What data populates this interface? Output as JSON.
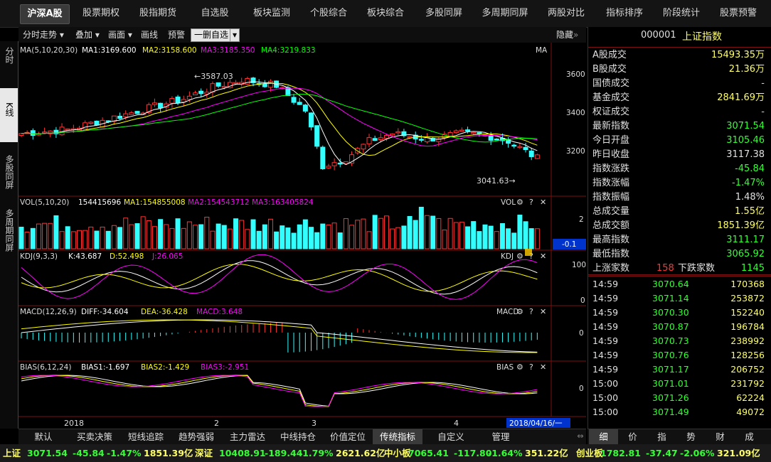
{
  "nav": [
    "沪深A股",
    "股票期权",
    "股指期货",
    "自选股",
    "板块监测",
    "个股综合",
    "板块综合",
    "多股同屏",
    "多周期同屏",
    "两股对比",
    "指标排序",
    "阶段统计",
    "股票预警"
  ],
  "toolbar": {
    "tf": "分时走势",
    "overlay": "叠加",
    "draw": "画面",
    "line": "画线",
    "alert": "预警",
    "del": "一删自选",
    "hide": "隐藏"
  },
  "lefttabs": [
    "分时",
    "K线",
    "多股同屏",
    "多周期同屏"
  ],
  "panes": {
    "ma": {
      "label": "MA(5,10,20,30)",
      "ma1": "MA1:3169.600",
      "ma2": "MA2:3158.600",
      "ma3": "MA3:3185.350",
      "ma4": "MA4:3219.833",
      "tag": "MA"
    },
    "vol": {
      "label": "VOL(5,10,20)",
      "v": "154415696",
      "ma1": "MA1:154855008",
      "ma2": "MA2:154543712",
      "ma3": "MA3:163405824",
      "tag": "VOL"
    },
    "kdj": {
      "label": "KDJ(9,3,3)",
      "k": "K:43.687",
      "d": "D:52.498",
      "j": "J:26.065",
      "tag": "KDJ"
    },
    "macd": {
      "label": "MACD(12,26,9)",
      "diff": "DIFF:-34.604",
      "dea": "DEA:-36.428",
      "m": "MACD:3.648",
      "tag": "MACD"
    },
    "bias": {
      "label": "BIAS(6,12,24)",
      "b1": "BIAS1:-1.697",
      "b2": "BIAS2:-1.429",
      "b3": "BIAS3:-2.951",
      "tag": "BIAS"
    }
  },
  "annotations": {
    "high": "←3587.03",
    "low": "3041.63→"
  },
  "axes": {
    "price": [
      "3600",
      "3400",
      "3200"
    ],
    "vol": "2",
    "vol_cur": "-0.1",
    "kdj": [
      "100",
      "0"
    ],
    "macd": "0",
    "bias": "0",
    "xlabels": [
      "2018",
      "2",
      "3",
      "4"
    ],
    "date": "2018/04/16/一"
  },
  "rp": {
    "code": "000001",
    "name": "上证指数",
    "rows": [
      {
        "l": "A股成交",
        "v": "15493.35万",
        "c": "#ffff66"
      },
      {
        "l": "B股成交",
        "v": "21.36万",
        "c": "#ffff66"
      },
      {
        "l": "国债成交",
        "v": "-",
        "c": "#ccc"
      },
      {
        "l": "基金成交",
        "v": "2841.69万",
        "c": "#ffff66"
      },
      {
        "l": "权证成交",
        "v": "-",
        "c": "#ccc"
      },
      {
        "l": "最新指数",
        "v": "3071.54",
        "c": "#33ff33"
      },
      {
        "l": "今日开盘",
        "v": "3105.46",
        "c": "#33ff33"
      },
      {
        "l": "昨日收盘",
        "v": "3117.38",
        "c": "#e0e0e0"
      },
      {
        "l": "指数涨跌",
        "v": "-45.84",
        "c": "#33ff33"
      },
      {
        "l": "指数涨幅",
        "v": "-1.47%",
        "c": "#33ff33"
      },
      {
        "l": "指数振幅",
        "v": "1.48%",
        "c": "#e0e0e0"
      },
      {
        "l": "总成交量",
        "v": "1.55亿",
        "c": "#ffff66"
      },
      {
        "l": "总成交额",
        "v": "1851.39亿",
        "c": "#ffff66"
      },
      {
        "l": "最高指数",
        "v": "3111.17",
        "c": "#33ff33"
      },
      {
        "l": "最低指数",
        "v": "3065.92",
        "c": "#33ff33"
      }
    ],
    "up_label": "上涨家数",
    "up": "158",
    "down_label": "下跌家数",
    "down": "1145",
    "ticks": [
      {
        "t": "14:59",
        "p": "3070.64",
        "v": "170368"
      },
      {
        "t": "14:59",
        "p": "3071.14",
        "v": "253872"
      },
      {
        "t": "14:59",
        "p": "3070.30",
        "v": "152240"
      },
      {
        "t": "14:59",
        "p": "3070.87",
        "v": "196784"
      },
      {
        "t": "14:59",
        "p": "3070.73",
        "v": "238992"
      },
      {
        "t": "14:59",
        "p": "3070.76",
        "v": "128256"
      },
      {
        "t": "14:59",
        "p": "3071.17",
        "v": "206752"
      },
      {
        "t": "15:00",
        "p": "3071.01",
        "v": "231792"
      },
      {
        "t": "15:00",
        "p": "3071.26",
        "v": "62224"
      },
      {
        "t": "15:00",
        "p": "3071.49",
        "v": "49072"
      }
    ]
  },
  "btabs": [
    "默认",
    "买卖决策",
    "短线追踪",
    "趋势强弱",
    "主力雷达",
    "中线持仓",
    "价值定位",
    "传统指标",
    "自定义",
    "管理"
  ],
  "rtabs": [
    "细",
    "价",
    "指",
    "势",
    "财",
    "成"
  ],
  "ticker": [
    {
      "n": "上证",
      "p": "3071.54",
      "c": "-45.84",
      "pc": "-1.47%",
      "a": "1851.39亿"
    },
    {
      "n": "深证",
      "p": "10408.91",
      "c": "-189.44",
      "pc": "-1.79%",
      "a": "2621.62亿"
    },
    {
      "n": "中小板",
      "p": "7065.41",
      "c": "-117.80",
      "pc": "-1.64%",
      "a": "351.22亿"
    },
    {
      "n": "创业板",
      "p": "1782.81",
      "c": "-37.47",
      "pc": "-2.06%",
      "a": "321.09亿"
    }
  ],
  "colors": {
    "up": "#ff3333",
    "down": "#33ffff",
    "ma1": "#ffffff",
    "ma2": "#ffff00",
    "ma3": "#ff00ff",
    "ma4": "#00ff00"
  }
}
